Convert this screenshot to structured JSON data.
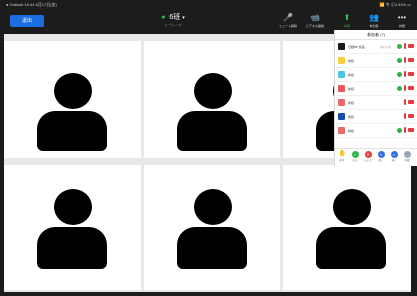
{
  "status_bar": {
    "left": "● Outlook 16:44 6月17日(金)",
    "right": "📶 令 Ⓒ4 81% ▭"
  },
  "toolbar": {
    "leave_label": "退出",
    "meeting_name": "6班",
    "meeting_sub": "ミーティング",
    "actions": [
      {
        "icon": "mic-muted-icon",
        "glyph": "🎤",
        "label": "ミュート解除"
      },
      {
        "icon": "video-off-icon",
        "glyph": "📹",
        "label": "ビデオの開始"
      },
      {
        "icon": "share-icon",
        "glyph": "⬆",
        "label": "共有"
      },
      {
        "icon": "participants-icon",
        "glyph": "👥",
        "label": "参加者"
      },
      {
        "icon": "more-icon",
        "glyph": "•••",
        "label": "詳細"
      }
    ]
  },
  "participants_panel": {
    "title": "参加者 (7)",
    "rows": [
      {
        "name": "日経BP 民宮...",
        "role": "(ホスト)",
        "avatar_color": "#1a1a1a",
        "video": true,
        "muted": true
      },
      {
        "name": "新様",
        "role": "",
        "avatar_color": "#f5d23a",
        "video": true,
        "muted": true
      },
      {
        "name": "新様",
        "role": "",
        "avatar_color": "#4fc3e8",
        "video": true,
        "muted": true
      },
      {
        "name": "新様",
        "role": "",
        "avatar_color": "#e85a5a",
        "video": true,
        "muted": true
      },
      {
        "name": "新様",
        "role": "",
        "avatar_color": "#e86a6a",
        "video": false,
        "muted": true
      },
      {
        "name": "新様",
        "role": "",
        "avatar_color": "#1a4fa8",
        "video": false,
        "muted": true
      },
      {
        "name": "新様",
        "role": "",
        "avatar_color": "#e86a6a",
        "video": true,
        "muted": true
      }
    ],
    "footer": [
      {
        "icon": "raise-hand-icon",
        "glyph": "✋",
        "label": "挙手",
        "color": "#ffffff"
      },
      {
        "icon": "yes-icon",
        "glyph": "✓",
        "label": "はい",
        "color": "#2fb24b"
      },
      {
        "icon": "no-icon",
        "glyph": "✕",
        "label": "いいえ",
        "color": "#e63b3b"
      },
      {
        "icon": "slower-icon",
        "glyph": "«",
        "label": "遅く",
        "color": "#3a6ee0"
      },
      {
        "icon": "faster-icon",
        "glyph": "»",
        "label": "速く",
        "color": "#3a6ee0"
      },
      {
        "icon": "more-reactions-icon",
        "glyph": "…",
        "label": "詳細",
        "color": "#9aa3b5"
      }
    ]
  },
  "video_tiles": 6
}
